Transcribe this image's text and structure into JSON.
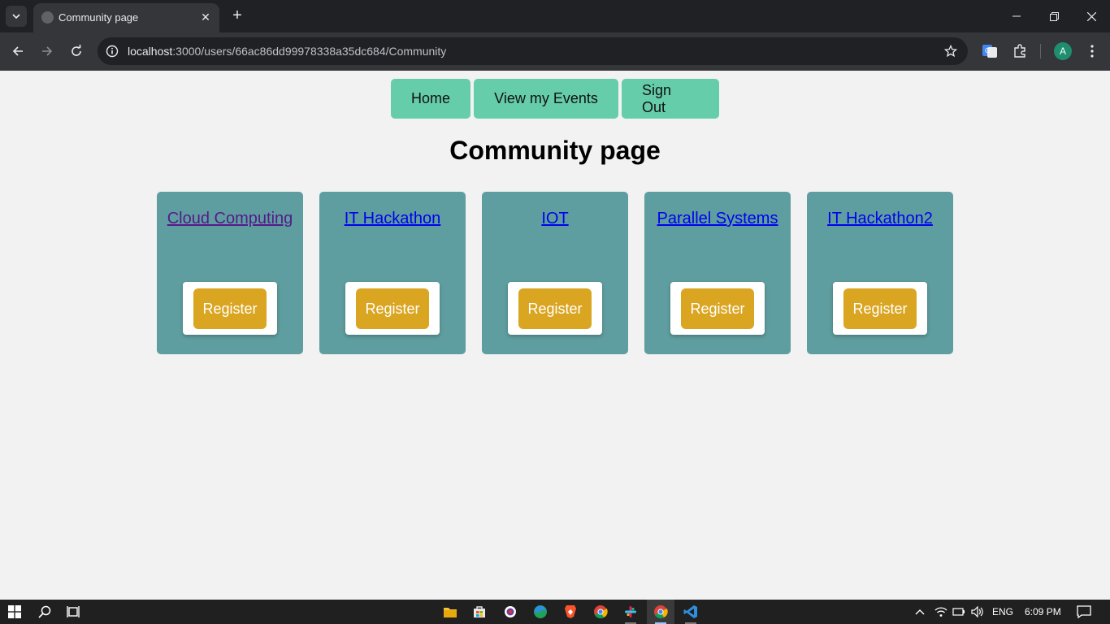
{
  "browser": {
    "tab_title": "Community page",
    "url_host": "localhost",
    "url_rest": ":3000/users/66ac86dd99978338a35dc684/Community",
    "profile_initial": "A"
  },
  "nav": {
    "home": "Home",
    "view_events": "View my Events",
    "sign_out": "Sign Out"
  },
  "page_title": "Community page",
  "communities": [
    {
      "name": "Cloud Computing",
      "register": "Register",
      "visited": true
    },
    {
      "name": "IT Hackathon",
      "register": "Register",
      "visited": false
    },
    {
      "name": "IOT",
      "register": "Register",
      "visited": false
    },
    {
      "name": "Parallel Systems",
      "register": "Register",
      "visited": false
    },
    {
      "name": "IT Hackathon2",
      "register": "Register",
      "visited": false
    }
  ],
  "colors": {
    "nav_button": "#66cdaa",
    "card": "#5f9ea0",
    "register_button": "#daa520",
    "link": "#0000ee",
    "visited_link": "#551a8b"
  },
  "taskbar": {
    "language": "ENG",
    "time": "6:09 PM"
  }
}
